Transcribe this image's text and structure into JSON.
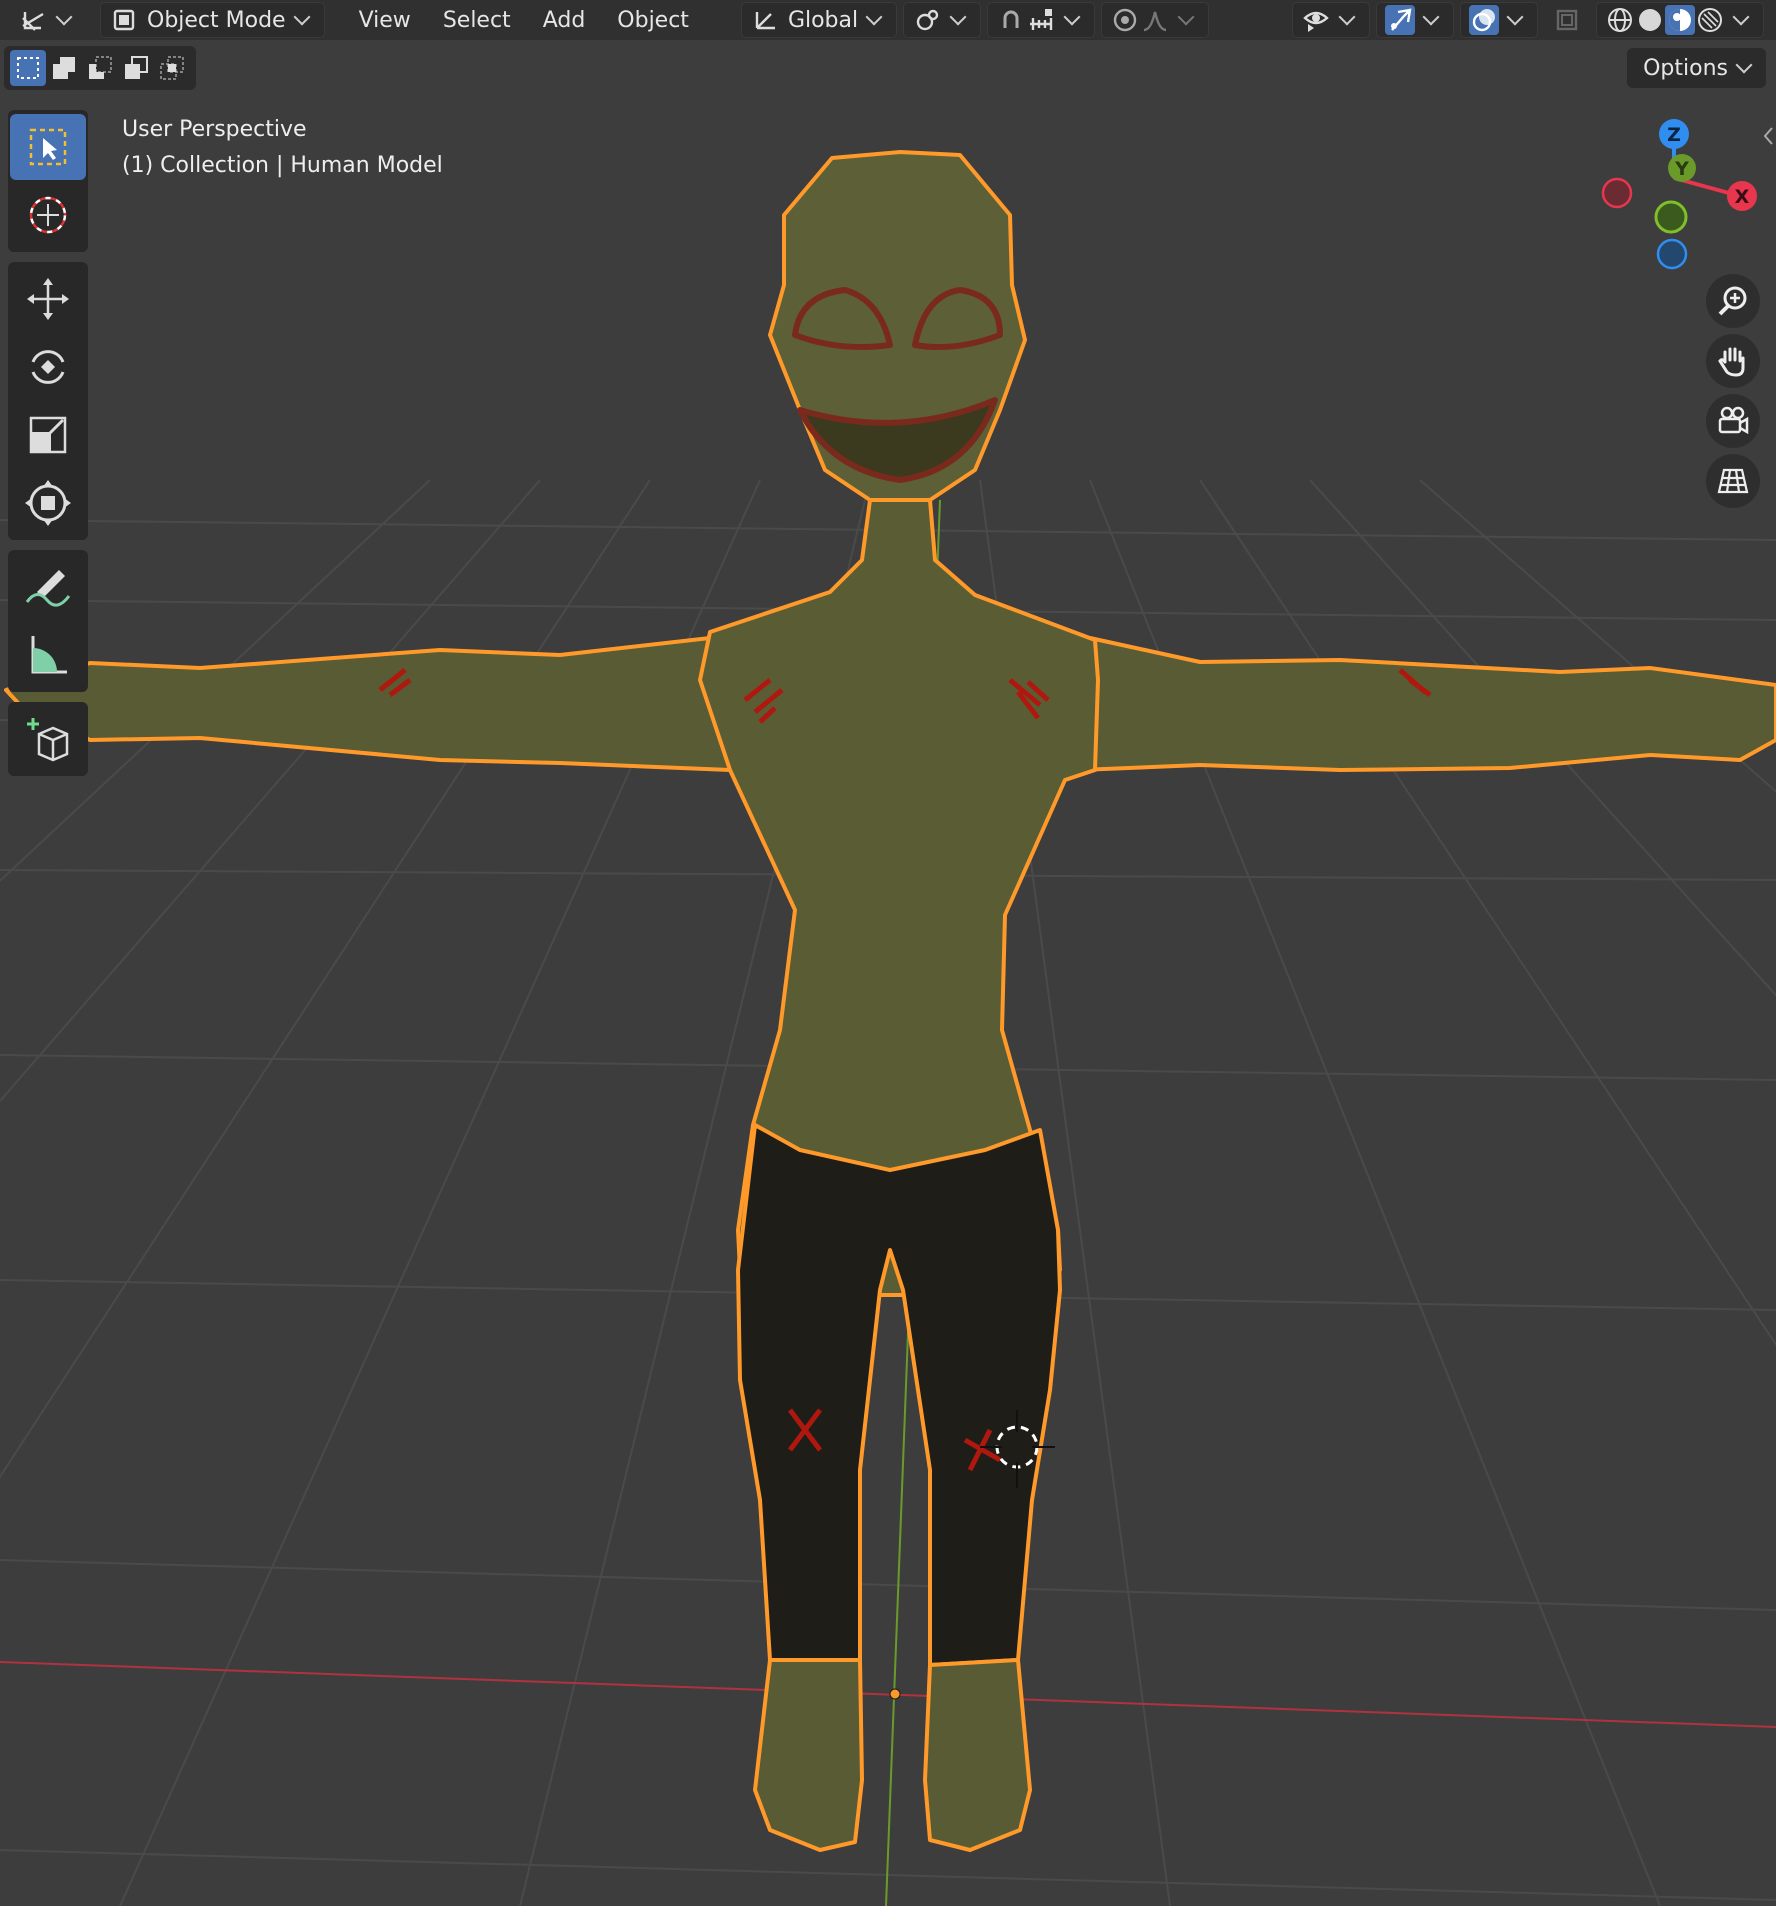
{
  "header": {
    "mode_label": "Object Mode",
    "menus": [
      "View",
      "Select",
      "Add",
      "Object"
    ],
    "transform_orientation": "Global"
  },
  "toolbar_options_label": "Options",
  "viewport": {
    "view_name": "User Perspective",
    "collection_info": "(1) Collection | Human Model"
  },
  "gizmo": {
    "z_label": "Z",
    "y_label": "Y",
    "x_label": "X"
  },
  "colors": {
    "selection_outline": "#ff9a2a",
    "active_tool": "#4772b3",
    "x_axis": "#e8364f",
    "y_axis": "#7fbf2a",
    "z_axis": "#2f8ef0",
    "skin": "#5b5e34",
    "pants": "#1c1b16"
  },
  "icons": [
    "editor-type-icon",
    "object-mode-icon",
    "transform-orientation-icon",
    "pivot-icon",
    "snap-icon",
    "snap-increment-icon",
    "proportional-edit-icon",
    "falloff-icon",
    "visibility-icon",
    "gizmo-icon",
    "overlay-icon",
    "xray-icon",
    "wireframe-shading-icon",
    "solid-shading-icon",
    "material-shading-icon",
    "rendered-shading-icon",
    "select-box-icon",
    "cursor-icon",
    "move-icon",
    "rotate-icon",
    "scale-icon",
    "transform-icon",
    "annotate-icon",
    "measure-icon",
    "add-cube-icon",
    "zoom-icon",
    "pan-hand-icon",
    "camera-icon",
    "grid-view-icon"
  ]
}
